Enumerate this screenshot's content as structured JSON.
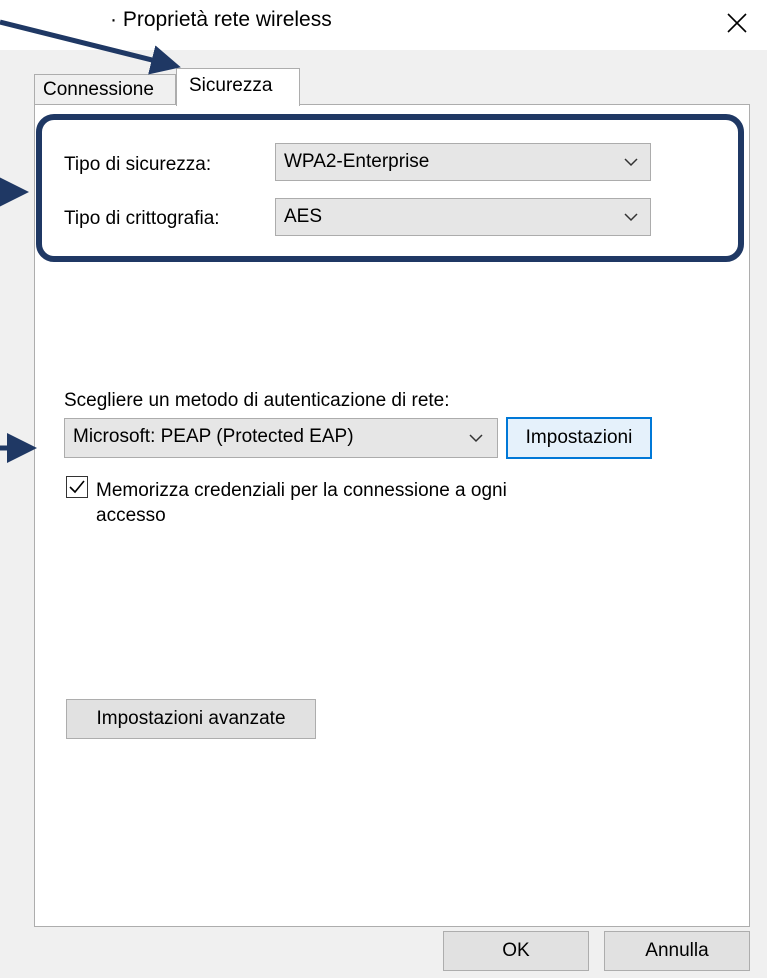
{
  "window": {
    "title": "· Proprietà rete wireless"
  },
  "tabs": [
    {
      "label": "Connessione",
      "selected": false
    },
    {
      "label": "Sicurezza",
      "selected": true
    }
  ],
  "security": {
    "type_label": "Tipo di sicurezza:",
    "type_value": "WPA2-Enterprise",
    "encryption_label": "Tipo di crittografia:",
    "encryption_value": "AES"
  },
  "auth": {
    "method_label": "Scegliere un metodo di autenticazione di rete:",
    "method_value": "Microsoft: PEAP (Protected EAP)",
    "settings_button": "Impostazioni",
    "remember_credentials_label": "Memorizza credenziali per la connessione a ogni accesso",
    "remember_credentials_checked": true
  },
  "advanced_button": "Impostazioni avanzate",
  "footer": {
    "ok_label": "OK",
    "cancel_label": "Annulla"
  },
  "annotation_color": "#1f3864"
}
